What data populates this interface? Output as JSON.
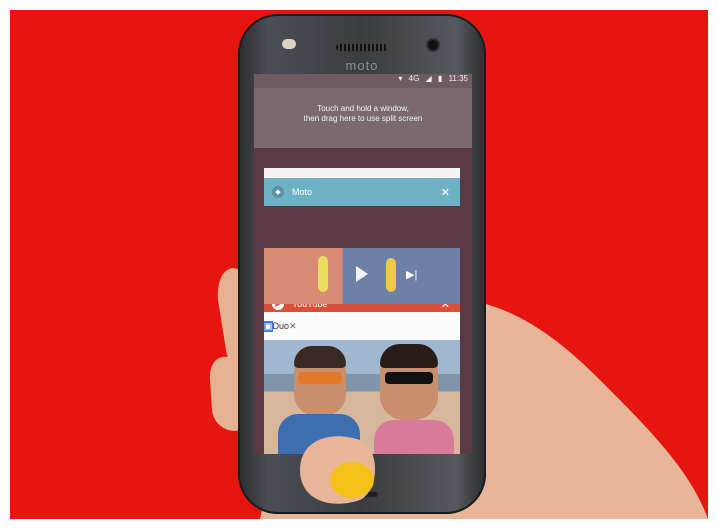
{
  "phone": {
    "brand": "moto",
    "status": {
      "network": "4G",
      "time": "11:35"
    },
    "drop_hint_line1": "Touch and hold a window,",
    "drop_hint_line2": "then drag here to use split screen"
  },
  "recents": [
    {
      "label": "Moto",
      "color": "#6fb1c4",
      "icon": "moto-icon",
      "close": "✕"
    },
    {
      "label": "YouTube",
      "color": "#d9503b",
      "icon": "youtube-icon",
      "close": "✕"
    },
    {
      "label": "Duo",
      "color": "#fafafa",
      "icon": "duo-icon",
      "close": "✕"
    }
  ],
  "colors": {
    "background": "#e6150f",
    "accent_nail": "#f2c21a"
  }
}
